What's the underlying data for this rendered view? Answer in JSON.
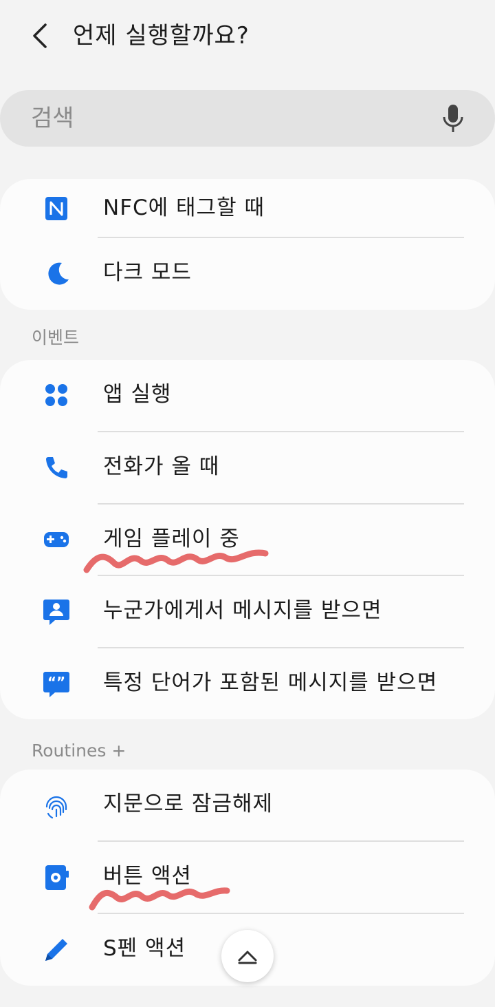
{
  "header": {
    "title": "언제 실행할까요?",
    "back_icon": "back-arrow-icon"
  },
  "search": {
    "placeholder": "검색",
    "mic_icon": "microphone-icon"
  },
  "group1": {
    "items": [
      {
        "label": "NFC에 태그할 때",
        "icon": "nfc-icon"
      },
      {
        "label": "다크 모드",
        "icon": "moon-icon"
      }
    ]
  },
  "events": {
    "header": "이벤트",
    "items": [
      {
        "label": "앱 실행",
        "icon": "apps-icon"
      },
      {
        "label": "전화가 올 때",
        "icon": "phone-icon"
      },
      {
        "label": "게임 플레이 중",
        "icon": "gamepad-icon"
      },
      {
        "label": "누군가에게서 메시지를 받으면",
        "icon": "person-message-icon"
      },
      {
        "label": "특정 단어가 포함된 메시지를 받으면",
        "icon": "quote-message-icon"
      }
    ]
  },
  "routines_plus": {
    "header": "Routines +",
    "items": [
      {
        "label": "지문으로 잠금해제",
        "icon": "fingerprint-icon"
      },
      {
        "label": "버튼 액션",
        "icon": "button-gear-icon"
      },
      {
        "label": "S펜 액션",
        "icon": "pen-icon"
      }
    ]
  },
  "scroll_top_icon": "chevron-up-icon",
  "colors": {
    "accent": "#1a73e8",
    "scribble": "#e35b5b",
    "background": "#f3f3f3",
    "card": "#fcfcfc"
  }
}
